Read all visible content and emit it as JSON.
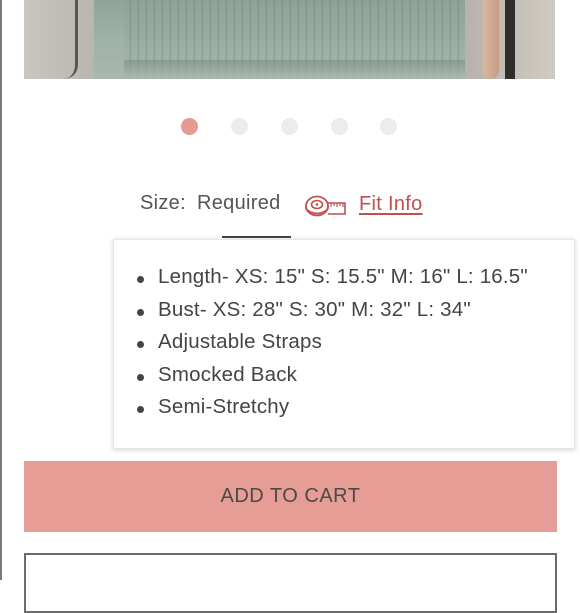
{
  "gallery": {
    "dot_count": 5,
    "active_index": 0,
    "colors": {
      "active": "#e79a90",
      "inactive": "#ececec"
    }
  },
  "size": {
    "label": "Size:",
    "value": "Required",
    "fit_info_label": "Fit Info",
    "icon": "measuring-tape-icon"
  },
  "fit_info": {
    "items": [
      "Length- XS: 15\" S: 15.5\" M: 16\" L: 16.5\"",
      "Bust- XS: 28\" S: 30\" M: 32\" L: 34\"",
      "Adjustable Straps",
      "Smocked Back",
      "Semi-Stretchy"
    ]
  },
  "cart": {
    "add_label": "ADD TO CART",
    "button_color": "#e69d95"
  },
  "accent_color": "#c0504f"
}
